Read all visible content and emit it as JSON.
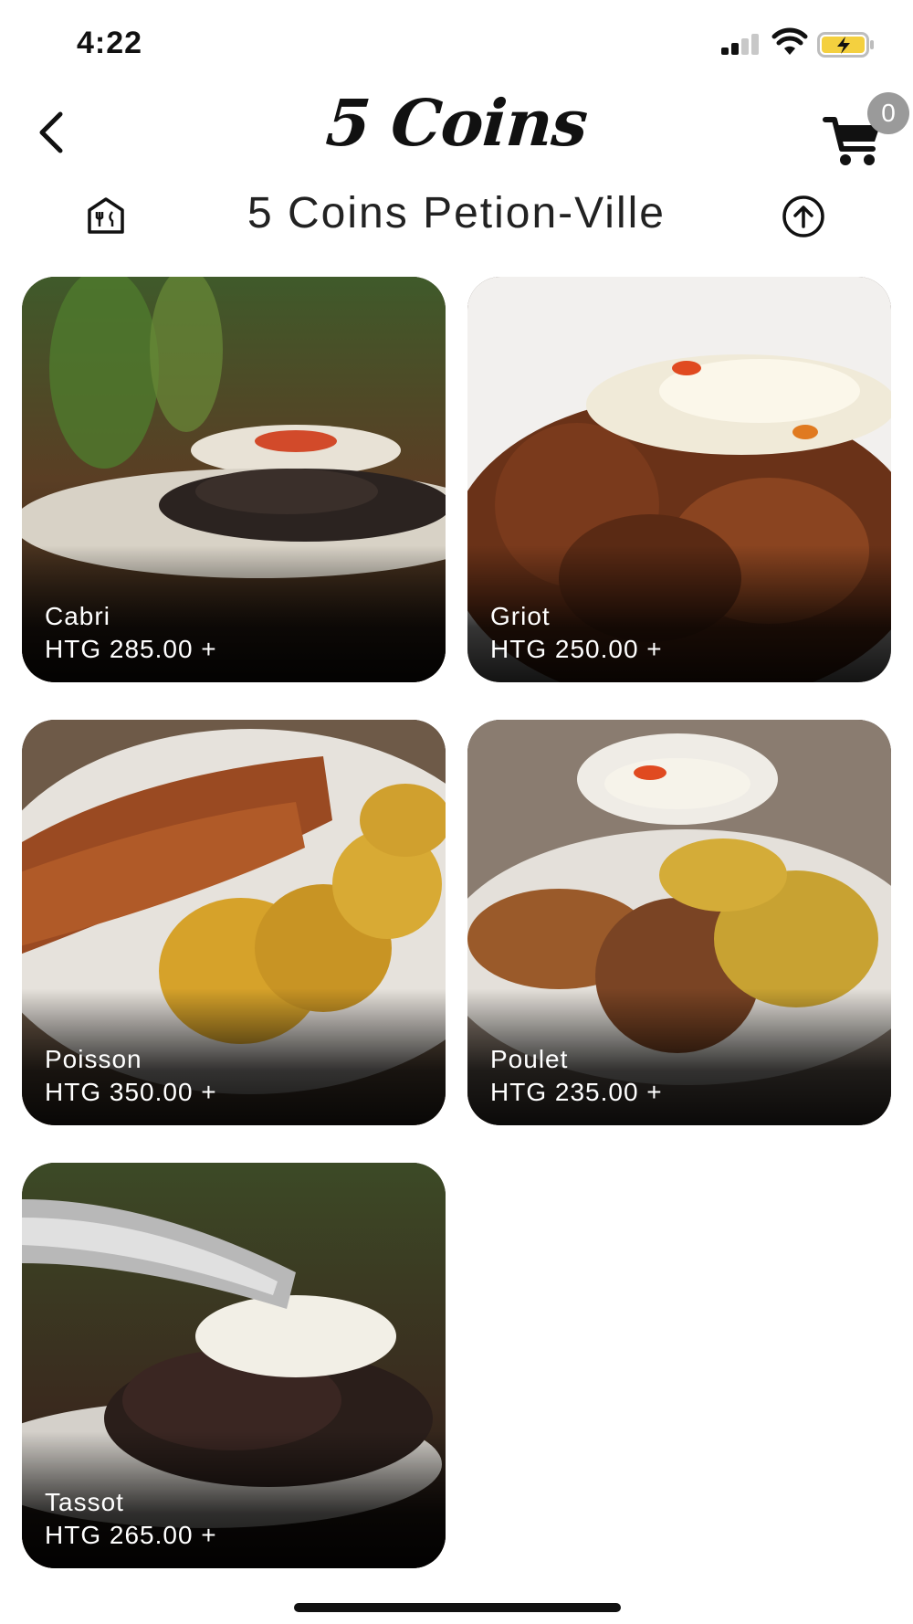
{
  "status_bar": {
    "time": "4:22"
  },
  "header": {
    "logo_text": "5 Coins",
    "cart_count": "0"
  },
  "store": {
    "name": "5 Coins Petion-Ville"
  },
  "menu_items": [
    {
      "name": "Cabri",
      "price": "HTG 285.00 +"
    },
    {
      "name": "Griot",
      "price": "HTG 250.00 +"
    },
    {
      "name": "Poisson",
      "price": "HTG 350.00 +"
    },
    {
      "name": "Poulet",
      "price": "HTG 235.00 +"
    },
    {
      "name": "Tassot",
      "price": "HTG 265.00 +"
    }
  ],
  "icons": {
    "back": "chevron-left-icon",
    "cart": "cart-icon",
    "store": "store-icon",
    "upload": "arrow-up-circle-icon"
  },
  "colors": {
    "badge": "#9a9a9a",
    "battery_fill": "#f4d03f"
  }
}
